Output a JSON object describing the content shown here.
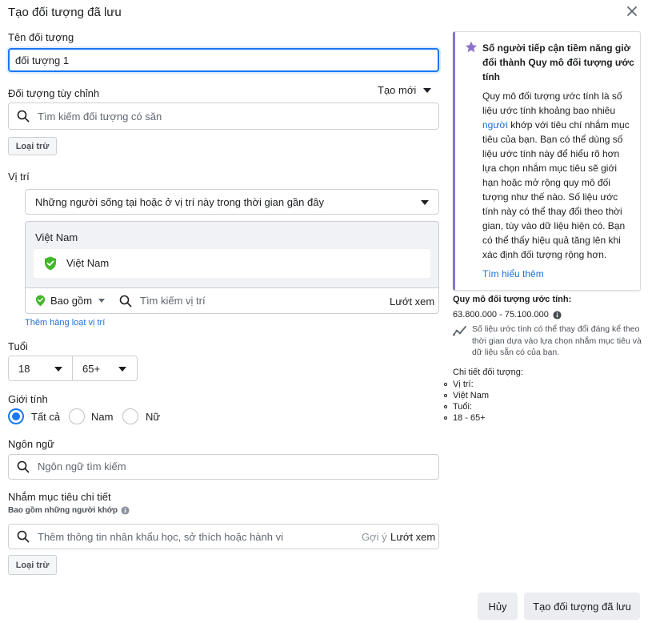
{
  "dialog": {
    "title": "Tạo đối tượng đã lưu"
  },
  "audience_name": {
    "label": "Tên đối tượng",
    "value": "đối tượng 1"
  },
  "custom_audience": {
    "label": "Đối tượng tùy chỉnh",
    "create_new": "Tạo mới",
    "search_placeholder": "Tìm kiếm đối tượng có săn",
    "exclude_button": "Loại trừ"
  },
  "location": {
    "label": "Vị trí",
    "dropdown_value": "Những người sống tại hoặc ở vị trí này trong thời gian gần đây",
    "country_header": "Việt Nam",
    "selected_location": "Việt Nam",
    "include_label": "Bao gồm",
    "search_placeholder": "Tìm kiếm vị trí",
    "browse": "Lướt xem",
    "bulk_add_link": "Thêm hàng loạt vị trí"
  },
  "age": {
    "label": "Tuổi",
    "min": "18",
    "max": "65+"
  },
  "gender": {
    "label": "Giới tính",
    "options": [
      "Tất cả",
      "Nam",
      "Nữ"
    ],
    "selected": "Tất cả"
  },
  "language": {
    "label": "Ngôn ngữ",
    "search_placeholder": "Ngôn ngữ tìm kiếm"
  },
  "detailed_targeting": {
    "label": "Nhắm mục tiêu chi tiết",
    "sublabel": "Bao gồm những người khớp",
    "search_placeholder": "Thêm thông tin nhân khẩu học, sở thích hoặc hành vi",
    "suggestions": "Gợi ý",
    "browse": "Lướt xem",
    "exclude_button": "Loại trừ"
  },
  "info_box": {
    "title": "Số người tiếp cận tiềm năng giờ đổi thành Quy mô đối tượng ước tính",
    "body_before_link": "Quy mô đối tượng ước tính là số liệu ước tính khoảng bao nhiêu",
    "body_link": "người",
    "body_after_link": "khớp với tiêu chí nhắm mục tiêu của bạn. Bạn có thể dùng số liệu ước tính này để hiểu rõ hơn lựa chọn nhắm mục tiêu sẽ giới hạn hoặc mở rộng quy mô đối tượng như thế nào. Số liệu ước tính này có thể thay đổi theo thời gian, tùy vào dữ liệu hiện có. Bạn có thể thấy hiệu quả tăng lên khi xác định đối tượng rộng hơn.",
    "learn_more": "Tìm hiểu thêm"
  },
  "estimate": {
    "label": "Quy mô đối tượng ước tính:",
    "range": "63.800.000 - 75.100.000",
    "note": "Số liệu ước tính có thể thay đổi đáng kể theo thời gian dựa vào lựa chọn nhắm mục tiêu và dữ liệu sẵn có của bạn."
  },
  "audience_details": {
    "label": "Chi tiết đối tượng:",
    "items": [
      "Vị trí:",
      "Việt Nam",
      "Tuổi:",
      "18 - 65+"
    ]
  },
  "footer": {
    "cancel": "Hủy",
    "create": "Tạo đối tượng đã lưu"
  },
  "colors": {
    "accent": "#1877f2",
    "info_border": "#8c72cb",
    "check_green": "#42b72a"
  }
}
